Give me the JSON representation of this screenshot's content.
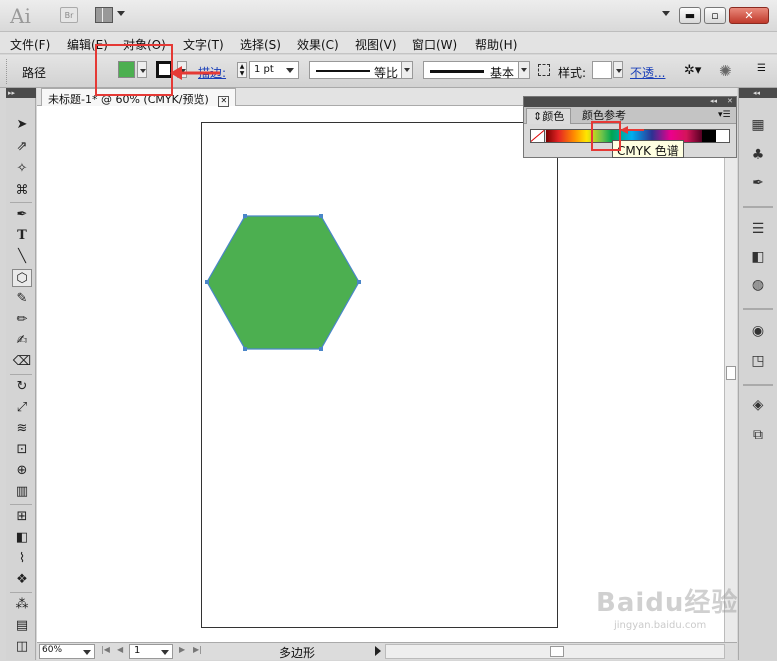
{
  "app": {
    "logo": "Ai",
    "bridge": "Br"
  },
  "window": {
    "min": "▬",
    "max": "▫",
    "close": "✕"
  },
  "menu": [
    "文件(F)",
    "编辑(E)",
    "对象(O)",
    "文字(T)",
    "选择(S)",
    "效果(C)",
    "视图(V)",
    "窗口(W)",
    "帮助(H)"
  ],
  "control": {
    "selection_type": "路径",
    "fill_color": "#4caf50",
    "stroke_label": "描边:",
    "stroke_width": "1 pt",
    "profile_label": "等比",
    "brush_label": "基本",
    "style_label": "样式:",
    "opacity_label": "不透..."
  },
  "document": {
    "tab_title": "未标题-1* @ 60% (CMYK/预览)",
    "shape_fill": "#4caf50",
    "shape_stroke": "#4a86c8"
  },
  "color_panel": {
    "tab_color": "颜色",
    "tab_guide": "颜色参考",
    "tooltip": "CMYK 色谱"
  },
  "status": {
    "zoom": "60%",
    "page": "1",
    "tool": "多边形"
  },
  "watermark": {
    "text": "Baidu经验",
    "sub": "jingyan.baidu.com"
  }
}
